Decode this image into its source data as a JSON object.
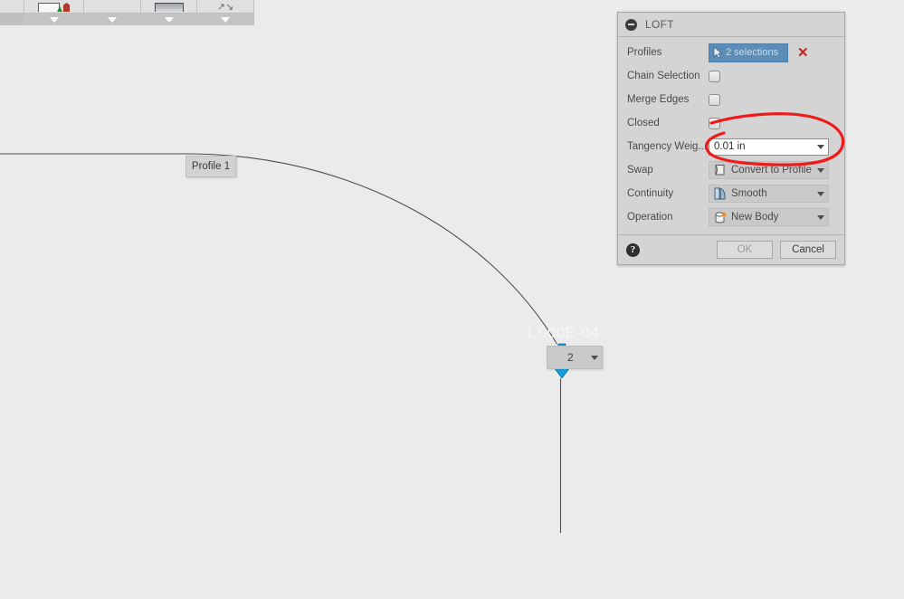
{
  "toolbar": {
    "cells": [
      {
        "name": "toolbar-cell-edge",
        "icon": "partial-icon",
        "has_caret": false
      },
      {
        "name": "toolbar-cell-sketch",
        "icon": "create-sketch-icon",
        "has_caret": true
      },
      {
        "name": "toolbar-cell-modify",
        "icon": "modify-icon",
        "has_caret": true
      },
      {
        "name": "toolbar-cell-plane",
        "icon": "construct-plane-icon",
        "has_caret": true
      },
      {
        "name": "toolbar-cell-inspect",
        "icon": "inspect-icon",
        "has_caret": true
      }
    ]
  },
  "canvas": {
    "profile_label": "Profile 1",
    "dimension_text": "1.000E-04",
    "stepper_value": "2",
    "arrow_color": "#18a0dd"
  },
  "dialog": {
    "title": "LOFT",
    "collapse_icon": "minus-circle-icon",
    "rows": [
      {
        "label": "Profiles",
        "type": "selection",
        "value": "2 selections",
        "icon": "cursor-arrow-icon",
        "clear_icon": "red-x-icon",
        "accent": "#5b8db8"
      },
      {
        "label": "Chain Selection",
        "type": "checkbox",
        "checked": false
      },
      {
        "label": "Merge Edges",
        "type": "checkbox",
        "checked": false
      },
      {
        "label": "Closed",
        "type": "checkbox",
        "checked": false
      },
      {
        "label": "Tangency Weig...",
        "type": "input",
        "value": "0.01 in",
        "placeholder": "0.01 in",
        "dropdown_icon": "chevron-down-icon"
      },
      {
        "label": "Swap",
        "type": "combo",
        "value": "Convert to Profile",
        "icon": "profile-face-icon",
        "dropdown_icon": "chevron-down-icon"
      },
      {
        "label": "Continuity",
        "type": "combo",
        "value": "Smooth",
        "icon": "smooth-continuity-icon",
        "dropdown_icon": "chevron-down-icon"
      },
      {
        "label": "Operation",
        "type": "combo",
        "value": "New Body",
        "icon": "new-body-icon",
        "dropdown_icon": "chevron-down-icon"
      }
    ],
    "footer": {
      "help_icon": "question-mark-icon",
      "ok_label": "OK",
      "ok_enabled": false,
      "cancel_label": "Cancel"
    }
  },
  "annotation": {
    "color": "#ee1b1b",
    "shape": "hand-drawn-ellipse"
  }
}
